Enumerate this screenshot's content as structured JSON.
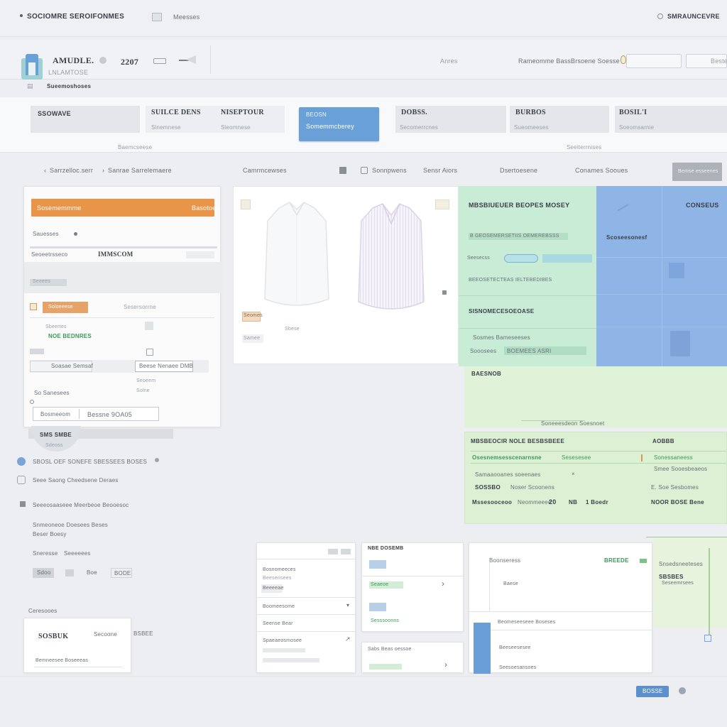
{
  "topbar": {
    "brand": "SOCIOMRE SEROIFONMES",
    "menu_item": "Meesses",
    "account": "SMRAUNCEVRE"
  },
  "header": {
    "logo_title": "AMUDLE.",
    "logo_sub": "LNLAMTOSE",
    "price": "2207",
    "sub_label": "Sueemoshoses",
    "link_1": "Anres",
    "link_2": "Rameomme Bass",
    "link_3": "Brsoene Soesse",
    "input_right": "Beste"
  },
  "categories": {
    "items": [
      {
        "label": "SSOWAVE",
        "sub": ""
      },
      {
        "label": "SUILCE DENS",
        "sub": "Sinemnese"
      },
      {
        "label": "NISEPTOUR",
        "sub": "Sieomnese"
      },
      {
        "label": "BEOSN",
        "sub": "Somemmcberey"
      },
      {
        "label": "DOBSS.",
        "sub": "Secomerrcnes"
      },
      {
        "label": "BURBOS",
        "sub": "Sueomeeses"
      },
      {
        "label": "BOSIL'I",
        "sub": "Soeomsarnie"
      }
    ],
    "bottom_left": "Baemcseese",
    "bottom_right": "Seeiterrnises"
  },
  "breadcrumb": {
    "items": [
      "Sarrzelloc.serr",
      "Sanrae Sarrelemaere"
    ],
    "tab_1": "Camrmcewses",
    "tab_2": "Sonnpwens",
    "tab_3": "Sensr Aiors",
    "tab_4": "Dsertoesene",
    "tab_5": "Conames Sooues",
    "action_button": "Bemse esseenes"
  },
  "left_panel": {
    "header_button": "Sosememmme",
    "header_right": "Basotoes",
    "row_1": "Sauesses",
    "field_label": "Seoeetrsseco",
    "field_value": "IMMSCOM",
    "gray_label": "Seeees",
    "tag_1": "Soloeeese",
    "tag_1_right": "Sesersorrne",
    "tag_2": "Sbeertes",
    "green_label": "NOE BEDNRES",
    "action_1": "Soasae Semsaf",
    "action_2": "Beese Nenaee DMB",
    "label_2": "Seoeem",
    "row_3": "So Sanesees",
    "row_4": "Solne",
    "input_1": "Bosmeeom",
    "input_2": "Bessne 9OA05",
    "tab_label": "SMS SMBE",
    "tab_sub": "Sdeoss"
  },
  "product_card": {
    "tag_1": "Seomes",
    "tag_2": "Samee",
    "center_label": "Sbese"
  },
  "info_panel": {
    "title": "MBSBIUEUER BEOPES MOSEY",
    "row_1": "B GEOSEMERSETIIS OEMEREBSSS",
    "row_2_label": "Seesecss",
    "row_3": "BEEOSETECTEAS IELTEBEDIBES",
    "heading": "SISNOMECESOEOASE",
    "sub_1": "Sosmes Bameseeses",
    "sub_2": "Sooosees",
    "sub_2_value": "BOEMEES ASRI",
    "blue_title": "CONSEUS",
    "blue_sub": "Scoseesonesf",
    "mid_label": "BAESNOB",
    "mid_link": "Soneeesdeon Soesnoet"
  },
  "order_panel": {
    "title": "MBSBEOCIR NOLE BESBSBEEE",
    "title_right": "AOBBB",
    "row_1": "Osesnemsesscenarnsne",
    "row_1_mid": "Sesesesee",
    "row_1_right": "Sonessaneess",
    "row_2": "Samaaooanes soeenaes",
    "row_2_right": "Smee Sooesbeaeos",
    "row_3": "SOSSBO",
    "row_3_mid": "Noser Scoonens",
    "row_3_right": "E. Soe Sesbomes",
    "row_4": "Mssesooceoo",
    "row_4_mid": "Neommeeee",
    "row_4_num": "20",
    "row_4_b": "NB",
    "row_4_c": "1 Boedr",
    "row_4_right": "NOOR BOSE Bene"
  },
  "left_list": {
    "item_1": "SBOSL OEF SONEFE SBESSEES BOSES",
    "item_2": "Seee Saong Cheedsene Deraes",
    "item_3": "Seeeosaaseee Meerbeoe Beooesoc",
    "item_4_a": "Snmeoneoe Doesees Beses",
    "item_4_b": "Beser Boesy",
    "label_a": "Sneresse",
    "label_b": "Seeeeees",
    "pill_1": "Sdoo",
    "pill_2": "Boe",
    "pill_3": "BODE",
    "bottom_label": "Ceresooes",
    "card_title": "SOSBUK",
    "card_right": "Secoone",
    "card_right_2": "BSBEE",
    "card_sub": "Bemneesee Boseeeas"
  },
  "bottom_cards": {
    "c1_label_1": "Bosnomeeces",
    "c1_label_2": "Beesensees",
    "c1_label_3": "Beeeeae",
    "c1_label_4": "Boomeesome",
    "c1_label_5": "Seense Bear",
    "c1_label_6": "Spaeaeosmosee",
    "c2_title": "NBE DOSEMB",
    "c2_row": "Seaeoe",
    "c2_row_2": "Sesssoonns",
    "c2_title_2": "Sabs Beas oessoe",
    "c3_title": "Boonseress",
    "c3_right": "BREEDE",
    "c3_row_1": "Baese",
    "c3_row_2": "Beomeseeseee Boseses",
    "c3_row_3": "Beeseesesee",
    "c3_row_4": "Seesoesansoes",
    "side_title": "Snsedsneeteses",
    "side_sub": "SBSBES",
    "side_sub_2": "Seseemrsees"
  },
  "footer": {
    "button": "BOSSE"
  },
  "colors": {
    "accent_blue": "#6aa0d8",
    "accent_orange": "#e8954a",
    "accent_green": "#3b9a57",
    "panel_green": "#c8ecd6",
    "panel_blue": "#8fb5e6"
  }
}
